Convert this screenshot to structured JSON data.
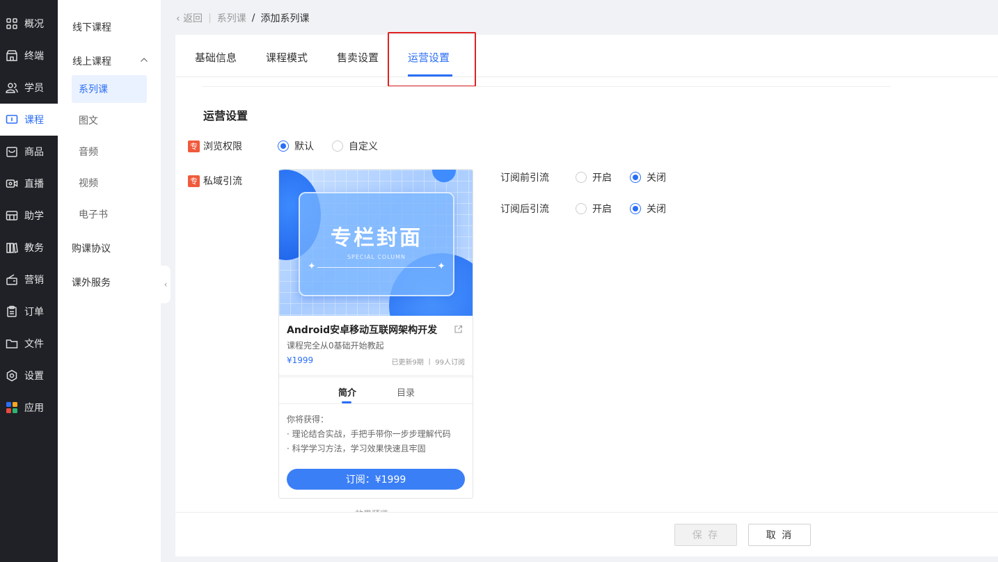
{
  "nav": {
    "items": [
      {
        "label": "概况",
        "icon": "grid-icon"
      },
      {
        "label": "终端",
        "icon": "store-icon"
      },
      {
        "label": "学员",
        "icon": "users-icon"
      },
      {
        "label": "课程",
        "icon": "course-icon"
      },
      {
        "label": "商品",
        "icon": "bag-icon"
      },
      {
        "label": "直播",
        "icon": "live-icon"
      },
      {
        "label": "助学",
        "icon": "assist-icon"
      },
      {
        "label": "教务",
        "icon": "books-icon"
      },
      {
        "label": "营销",
        "icon": "gift-icon"
      },
      {
        "label": "订单",
        "icon": "clipboard-icon"
      },
      {
        "label": "文件",
        "icon": "folder-icon"
      },
      {
        "label": "设置",
        "icon": "gear-icon"
      },
      {
        "label": "应用",
        "icon": "apps-icon"
      }
    ],
    "active_index": 3,
    "accent": "#2b6ef5"
  },
  "subnav": {
    "offline": "线下课程",
    "online": "线上课程",
    "children": [
      "系列课",
      "图文",
      "音频",
      "视频",
      "电子书"
    ],
    "active_child": "系列课",
    "agreement": "购课协议",
    "extra": "课外服务"
  },
  "breadcrumb": {
    "back": "返回",
    "parent": "系列课",
    "slash": "/",
    "current": "添加系列课"
  },
  "tabs": [
    "基础信息",
    "课程模式",
    "售卖设置",
    "运营设置"
  ],
  "active_tab": "运营设置",
  "section_title": "运营设置",
  "pro_tag": "专",
  "browse": {
    "label": "浏览权限",
    "options": [
      "默认",
      "自定义"
    ],
    "selected": "默认"
  },
  "private": {
    "label": "私域引流",
    "before": {
      "label": "订阅前引流",
      "options": [
        "开启",
        "关闭"
      ],
      "selected": "关闭"
    },
    "after": {
      "label": "订阅后引流",
      "options": [
        "开启",
        "关闭"
      ],
      "selected": "关闭"
    }
  },
  "preview": {
    "cover_title": "专栏封面",
    "cover_sub": "SPECIAL COLUMN",
    "course_title": "Android安卓移动互联网架构开发",
    "course_desc": "课程完全从0基础开始教起",
    "price": "¥1999",
    "meta": "已更新9期 丨 99人订阅",
    "tab_intro": "简介",
    "tab_catalog": "目录",
    "gain_title": "你将获得：",
    "gain_items": [
      "· 理论结合实战，手把手带你一步步理解代码",
      "· 科学学习方法，学习效果快速且牢固"
    ],
    "subscribe_btn": "订阅：¥1999"
  },
  "under_preview": "效果预览",
  "buttons": {
    "save": "保 存",
    "cancel": "取 消"
  }
}
